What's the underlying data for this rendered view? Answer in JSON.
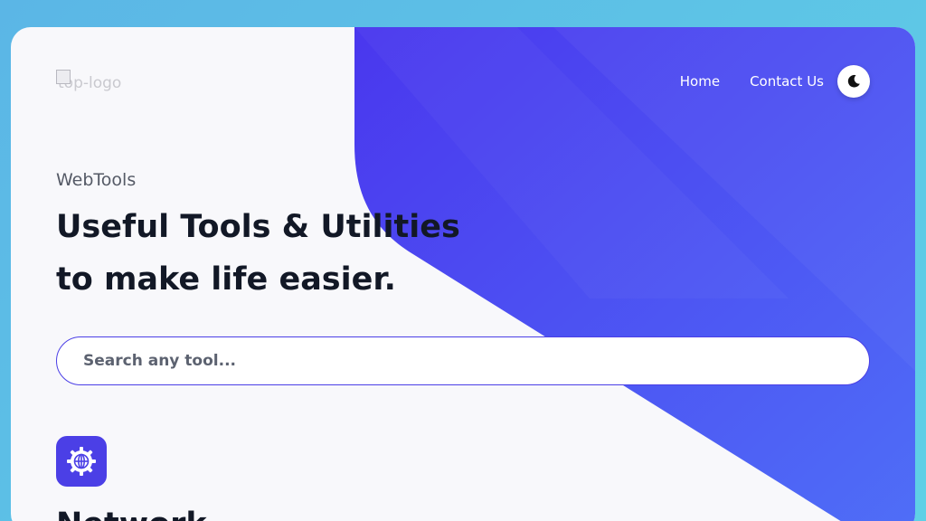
{
  "header": {
    "logo_alt": "top-logo",
    "nav": [
      {
        "label": "Home"
      },
      {
        "label": "Contact Us"
      }
    ],
    "theme_toggle_icon": "moon-icon"
  },
  "hero": {
    "eyebrow": "WebTools",
    "title_line1": "Useful Tools & Utilities",
    "title_line2": "to make life easier."
  },
  "search": {
    "placeholder": "Search any tool..."
  },
  "section": {
    "icon": "globe-gear-icon",
    "title": "Network"
  },
  "colors": {
    "accent": "#4b3fe6",
    "page_bg": "#5fc4e6",
    "card_bg": "#f8f8fb",
    "heading": "#121826"
  }
}
